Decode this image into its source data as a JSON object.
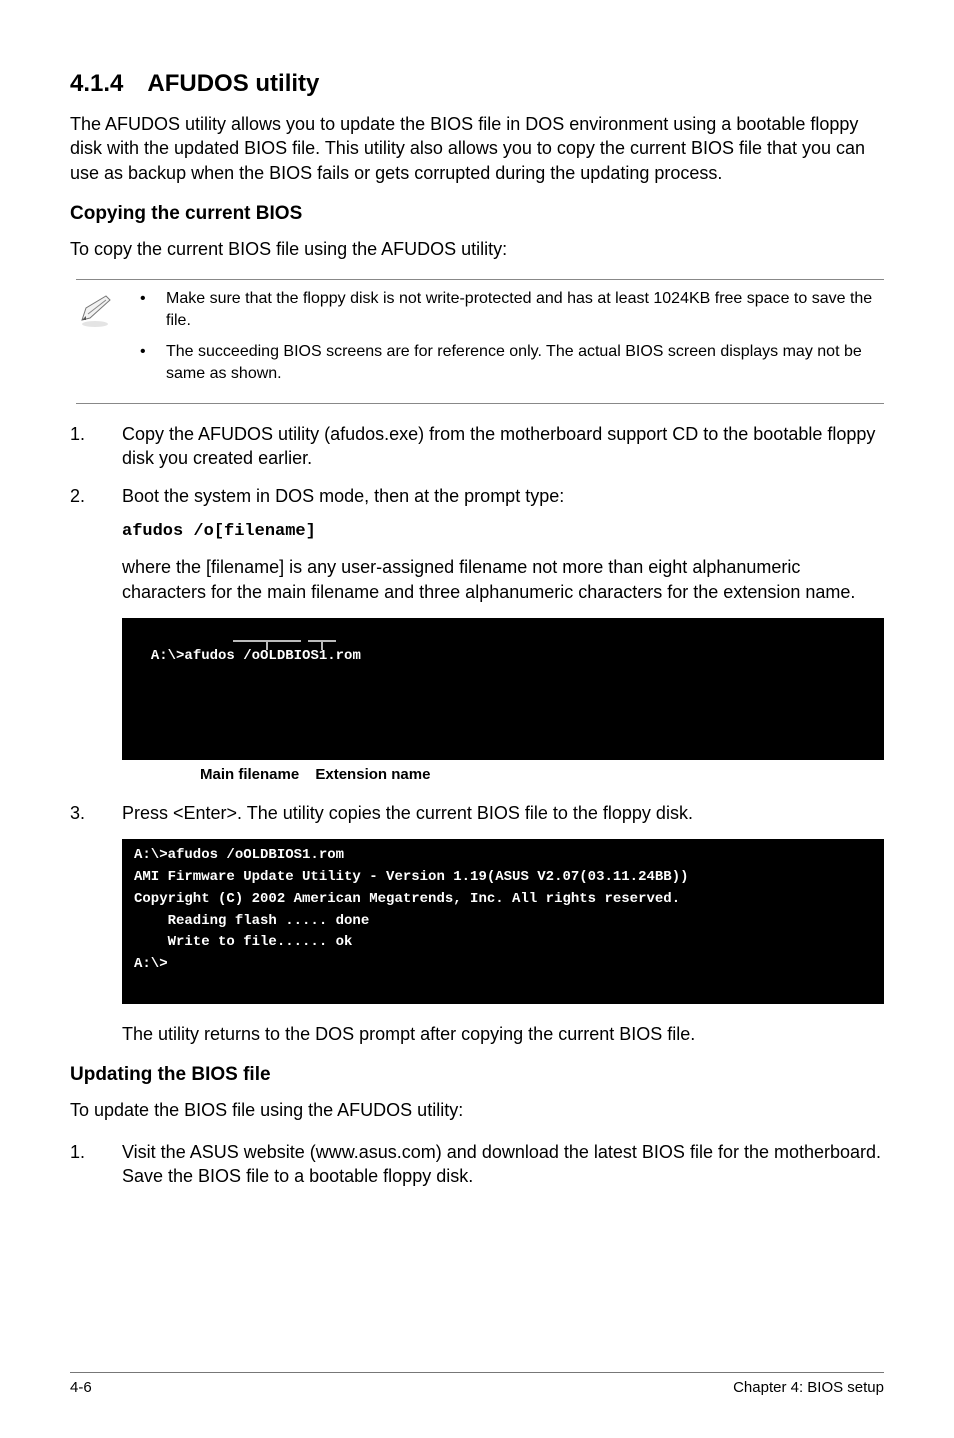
{
  "section": {
    "number": "4.1.4",
    "title": "AFUDOS utility"
  },
  "intro": "The AFUDOS utility allows you to update the BIOS file in DOS environment using a bootable floppy disk with the updated BIOS file. This utility also allows you to copy the current BIOS file that you can use as backup when the BIOS fails or gets corrupted during the updating process.",
  "copy": {
    "heading": "Copying the current BIOS",
    "lead": "To copy the current BIOS file using the AFUDOS utility:",
    "notes": [
      "Make sure that the floppy disk is not write-protected and has at least 1024KB free space to save the file.",
      "The succeeding BIOS screens are for reference only. The actual BIOS screen displays may not be same as shown."
    ],
    "steps": {
      "s1": {
        "num": "1.",
        "text": "Copy the AFUDOS utility (afudos.exe) from the motherboard support CD to the bootable floppy disk you created earlier."
      },
      "s2": {
        "num": "2.",
        "text": "Boot the system in DOS mode, then at the prompt type:"
      },
      "cmd": "afudos /o[filename]",
      "s2b": "where the [filename] is any user-assigned filename not more than eight alphanumeric characters  for the main filename and three alphanumeric characters for the extension name.",
      "term1": "A:\\>afudos /oOLDBIOS1.rom",
      "labels": {
        "main": "Main filename",
        "ext": "Extension name"
      },
      "s3": {
        "num": "3.",
        "text": "Press <Enter>. The utility copies the current BIOS file to the floppy disk."
      },
      "term2": "A:\\>afudos /oOLDBIOS1.rom\nAMI Firmware Update Utility - Version 1.19(ASUS V2.07(03.11.24BB))\nCopyright (C) 2002 American Megatrends, Inc. All rights reserved.\n    Reading flash ..... done\n    Write to file...... ok\nA:\\>",
      "after": "The utility returns to the DOS prompt after copying the current BIOS file."
    }
  },
  "update": {
    "heading": "Updating the BIOS file",
    "lead": "To update the BIOS file using the AFUDOS utility:",
    "steps": {
      "s1": {
        "num": "1.",
        "text": "Visit the ASUS website (www.asus.com) and download the latest BIOS file for the motherboard. Save the BIOS file to a bootable floppy disk."
      }
    }
  },
  "footer": {
    "left": "4-6",
    "right": "Chapter 4: BIOS setup"
  }
}
